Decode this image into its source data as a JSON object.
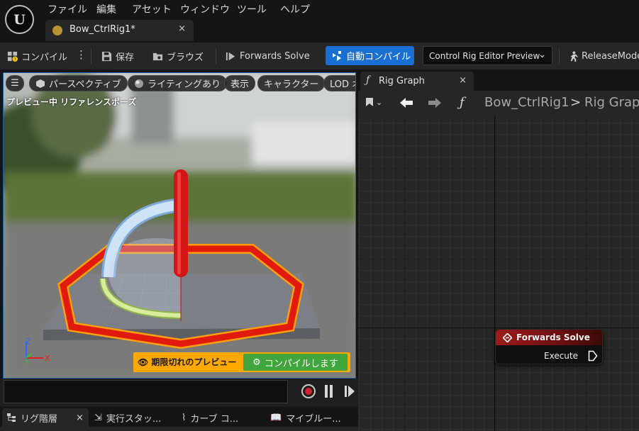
{
  "menu": [
    "ファイル",
    "編集",
    "アセット",
    "ウィンドウ",
    "ツール",
    "ヘルプ"
  ],
  "document_tab": {
    "label": "Bow_CtrlRig1*",
    "close": "×"
  },
  "toolbar": {
    "compile": "コンパイル",
    "save": "保存",
    "browse": "ブラウズ",
    "forwards_solve": "Forwards Solve",
    "auto_compile": "自動コンパイル",
    "preview_dropdown": "Control Rig Editor Preview",
    "release_mode": "ReleaseMode"
  },
  "viewport": {
    "buttons": [
      "パースペクティブ",
      "ライティングあり",
      "表示",
      "キャラクター",
      "LOD オ"
    ],
    "preview_label": "プレビュー中 リファレンスポーズ",
    "warning": "期限切れのプレビュー",
    "compile_now": "コンパイルします",
    "axes": {
      "z": "Z",
      "y": "Y",
      "x": "X"
    }
  },
  "bottom_tabs": [
    "リグ階層",
    "実行スタッ...",
    "カーブ コ...",
    "マイブルー..."
  ],
  "bottom_tab_close": "×",
  "graph": {
    "tab_label": "Rig Graph",
    "tab_close": "×",
    "fx_symbol": "ƒ",
    "breadcrumb": [
      "Bow_CtrlRig1",
      "Rig Graph"
    ],
    "breadcrumb_sep": ">",
    "node": {
      "title": "Forwards Solve",
      "pin": "Execute"
    }
  },
  "colors": {
    "accent_blue": "#1a6fd4",
    "warning": "#ffa800",
    "compile_green": "#40a53c",
    "node_red": "#9e1b1b"
  }
}
